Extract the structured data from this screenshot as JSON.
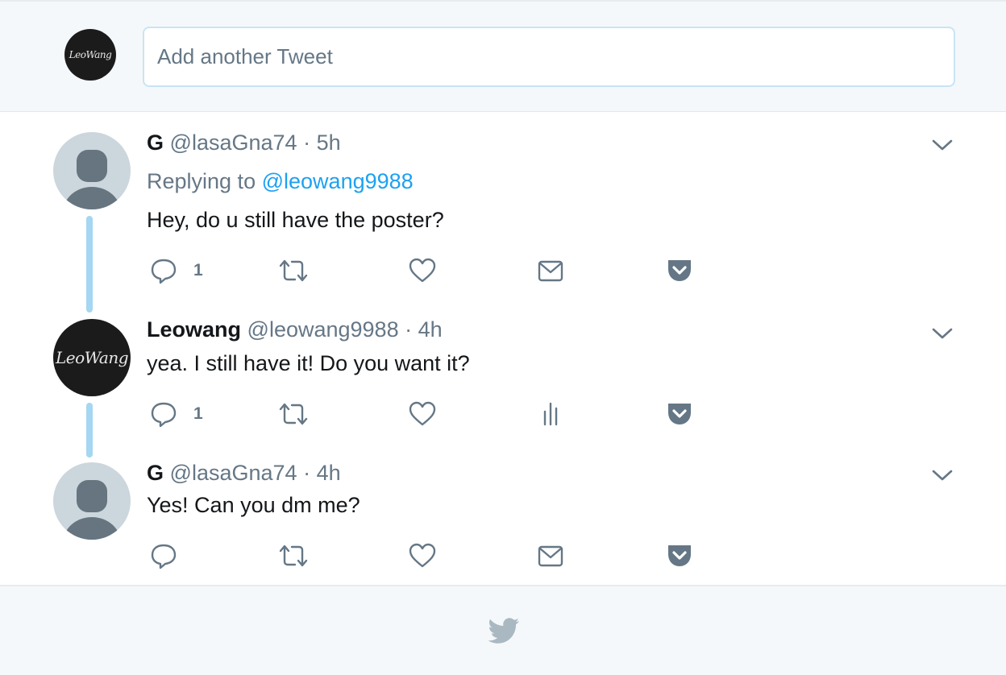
{
  "compose": {
    "avatar_label": "LeoWang",
    "placeholder": "Add another Tweet"
  },
  "tweets": [
    {
      "name": "G",
      "handle": "@lasaGna74",
      "separator": "·",
      "time": "5h",
      "replying_prefix": "Replying to",
      "replying_to": "@leowang9988",
      "text": "Hey, do u still have the poster?",
      "reply_count": "1",
      "fourth_action": "mail-icon"
    },
    {
      "name": "Leowang",
      "avatar_label": "LeoWang",
      "handle": "@leowang9988",
      "separator": "·",
      "time": "4h",
      "text": "yea. I still have it! Do you want it?",
      "reply_count": "1",
      "fourth_action": "analytics-icon"
    },
    {
      "name": "G",
      "handle": "@lasaGna74",
      "separator": "·",
      "time": "4h",
      "text": "Yes! Can you dm me?",
      "reply_count": "",
      "fourth_action": "mail-icon"
    }
  ],
  "colors": {
    "accent": "#1da1f2",
    "thread_line": "#a5d6f2",
    "muted": "#657786",
    "icon": "#657786"
  },
  "footer": {
    "icon": "twitter-bird-icon"
  }
}
